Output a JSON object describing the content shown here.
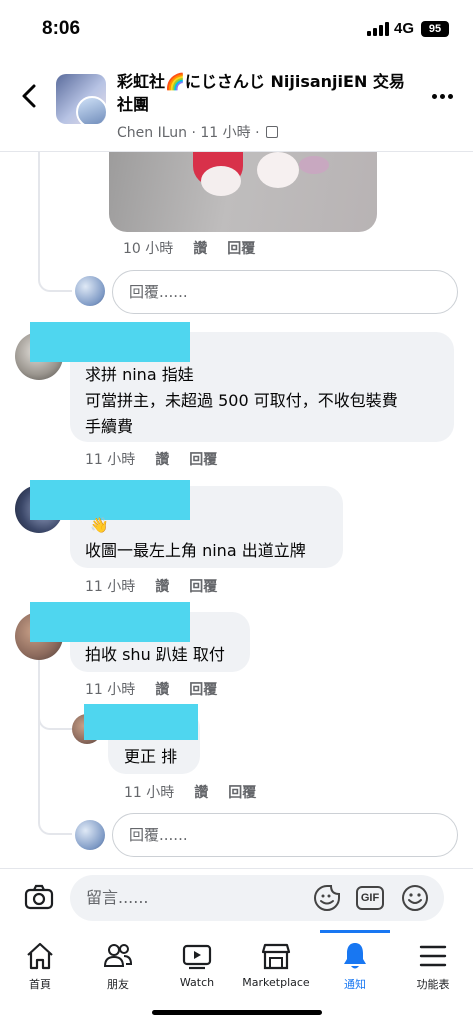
{
  "status_bar": {
    "time": "8:06",
    "network": "4G",
    "battery": "95"
  },
  "header": {
    "title": "彩虹社🌈にじさんじ NijisanjiEN 交易社團",
    "subtitle": "Chen ILun · 11 小時 ·"
  },
  "image_comment": {
    "time": "10 小時",
    "like": "讚",
    "reply": "回覆"
  },
  "reply_placeholder_1": "回覆......",
  "comments": [
    {
      "text_lines": [
        "求拼 nina 指娃",
        "可當拼主，未超過 500 可取付，不收包裝費",
        "手續費"
      ],
      "time": "11 小時",
      "like": "讚",
      "reply": "回覆"
    },
    {
      "emoji": "👋",
      "text_lines": [
        "收圖一最左上角 nina 出道立牌"
      ],
      "time": "11 小時",
      "like": "讚",
      "reply": "回覆"
    },
    {
      "text_lines": [
        "拍收 shu 趴娃 取付"
      ],
      "time": "11 小時",
      "like": "讚",
      "reply": "回覆"
    }
  ],
  "nested_reply": {
    "text": "更正 排",
    "time": "11 小時",
    "like": "讚",
    "reply": "回覆"
  },
  "reply_placeholder_2": "回覆......",
  "composer": {
    "placeholder": "留言......",
    "gif": "GIF"
  },
  "tabs": [
    {
      "label": "首頁",
      "icon": "home-icon"
    },
    {
      "label": "朋友",
      "icon": "friends-icon"
    },
    {
      "label": "Watch",
      "icon": "watch-icon"
    },
    {
      "label": "Marketplace",
      "icon": "marketplace-icon"
    },
    {
      "label": "通知",
      "icon": "bell-icon",
      "active": true
    },
    {
      "label": "功能表",
      "icon": "menu-icon"
    }
  ],
  "colors": {
    "accent": "#1877f2",
    "redaction": "#4fd6ef",
    "bubble": "#f0f2f5"
  }
}
